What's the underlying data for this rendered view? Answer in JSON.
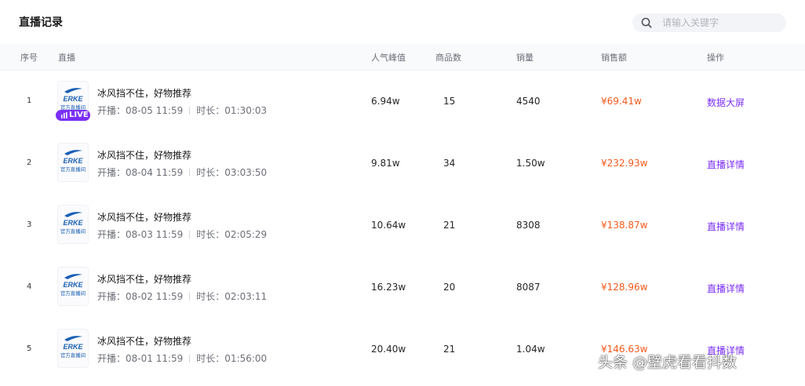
{
  "header": {
    "title": "直播记录",
    "search": {
      "placeholder": "请输入关键字",
      "value": ""
    }
  },
  "columns": {
    "index": "序号",
    "stream": "直播",
    "peak": "人气峰值",
    "products": "商品数",
    "sales_volume": "销量",
    "sales_amount": "销售额",
    "action": "操作"
  },
  "labels": {
    "start": "开播：",
    "duration": "时长：",
    "live": "LIVE",
    "thumb_brand": "ERKE",
    "thumb_sub": "官方直播间"
  },
  "rows": [
    {
      "index": "1",
      "title": "冰风挡不住，好物推荐",
      "start": "08-05 11:59",
      "duration": "01:30:03",
      "peak": "6.94w",
      "products": "15",
      "sales_volume": "4540",
      "sales_amount": "¥69.41w",
      "action": "数据大屏",
      "live": true
    },
    {
      "index": "2",
      "title": "冰风挡不住，好物推荐",
      "start": "08-04 11:59",
      "duration": "03:03:50",
      "peak": "9.81w",
      "products": "34",
      "sales_volume": "1.50w",
      "sales_amount": "¥232.93w",
      "action": "直播详情",
      "live": false
    },
    {
      "index": "3",
      "title": "冰风挡不住，好物推荐",
      "start": "08-03 11:59",
      "duration": "02:05:29",
      "peak": "10.64w",
      "products": "21",
      "sales_volume": "8308",
      "sales_amount": "¥138.87w",
      "action": "直播详情",
      "live": false
    },
    {
      "index": "4",
      "title": "冰风挡不住，好物推荐",
      "start": "08-02 11:59",
      "duration": "02:03:11",
      "peak": "16.23w",
      "products": "20",
      "sales_volume": "8087",
      "sales_amount": "¥128.96w",
      "action": "直播详情",
      "live": false
    },
    {
      "index": "5",
      "title": "冰风挡不住，好物推荐",
      "start": "08-01 11:59",
      "duration": "01:56:00",
      "peak": "20.40w",
      "products": "21",
      "sales_volume": "1.04w",
      "sales_amount": "¥146.63w",
      "action": "直播详情",
      "live": false
    }
  ],
  "watermark": "头条 @壁虎看看抖数",
  "colors": {
    "accent": "#7b2ff7",
    "sales": "#f25a1b",
    "brand_blue": "#1a5fb4"
  }
}
